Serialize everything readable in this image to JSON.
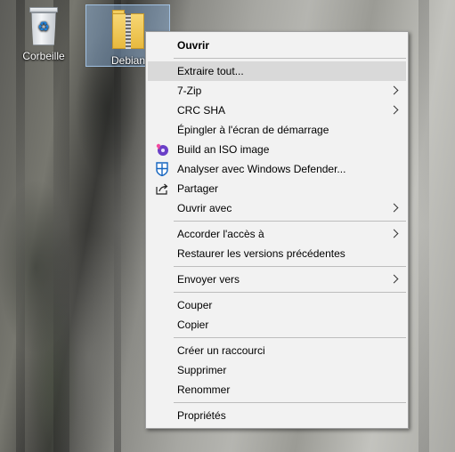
{
  "desktop": {
    "icons": [
      {
        "label": "Corbeille",
        "icon": "recycle-bin-icon"
      },
      {
        "label": "Debian",
        "icon": "zip-folder-icon"
      }
    ]
  },
  "menu": {
    "items": [
      {
        "label": "Ouvrir",
        "bold": true
      },
      {
        "label": "Extraire tout...",
        "hover": true
      },
      {
        "label": "7-Zip",
        "submenu": true
      },
      {
        "label": "CRC SHA",
        "submenu": true
      },
      {
        "label": "Épingler à l'écran de démarrage"
      },
      {
        "label": "Build an ISO image",
        "icon": "iso-image-icon"
      },
      {
        "label": "Analyser avec Windows Defender...",
        "icon": "windows-defender-icon"
      },
      {
        "label": "Partager",
        "icon": "share-icon"
      },
      {
        "label": "Ouvrir avec",
        "submenu": true
      },
      {
        "label": "Accorder l'accès à",
        "submenu": true
      },
      {
        "label": "Restaurer les versions précédentes"
      },
      {
        "label": "Envoyer vers",
        "submenu": true
      },
      {
        "label": "Couper"
      },
      {
        "label": "Copier"
      },
      {
        "label": "Créer un raccourci"
      },
      {
        "label": "Supprimer"
      },
      {
        "label": "Renommer"
      },
      {
        "label": "Propriétés"
      }
    ]
  },
  "colors": {
    "menu_background": "#f2f2f2",
    "menu_hover": "#d9d9d9",
    "selection": "#8cb4e1"
  }
}
